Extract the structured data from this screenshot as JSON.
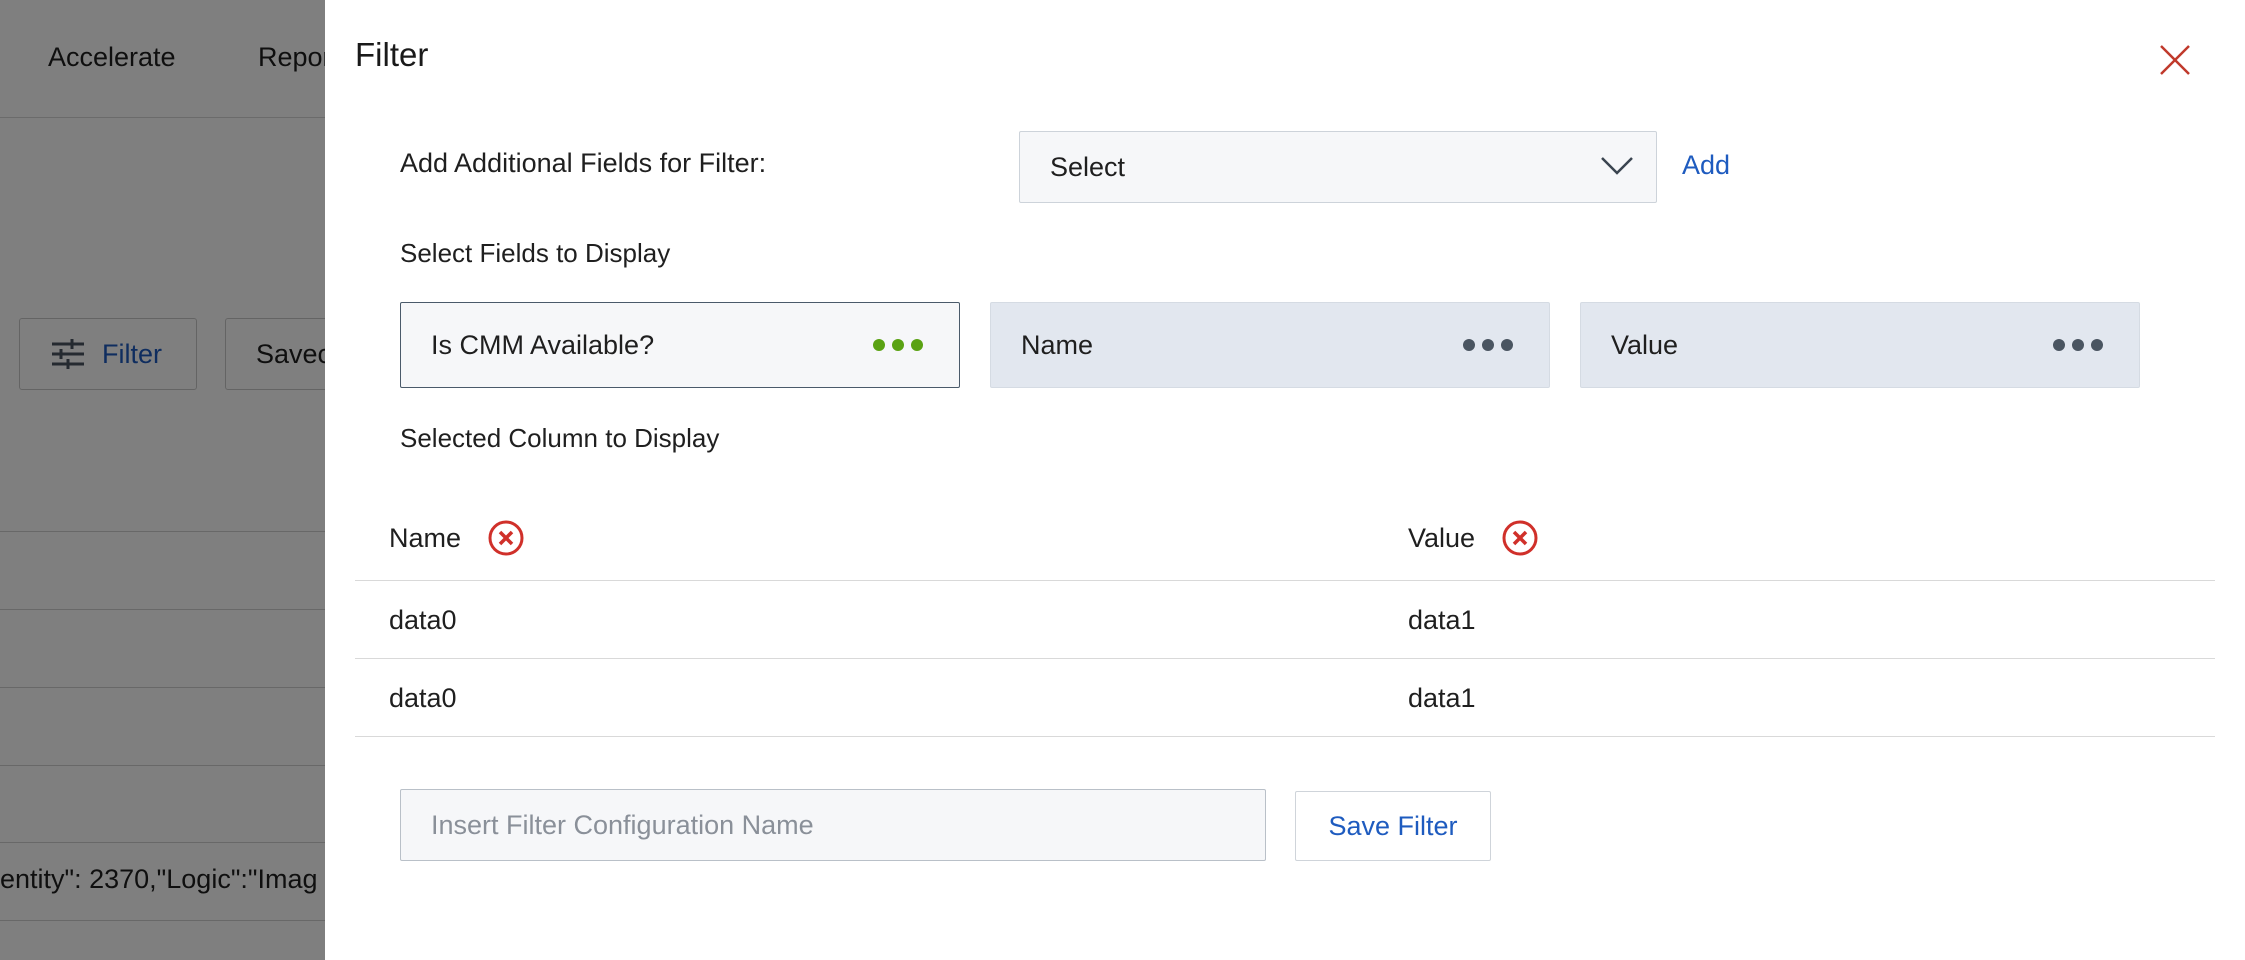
{
  "background": {
    "nav_items": [
      "Accelerate",
      "Repor"
    ],
    "filter_button": "Filter",
    "saved_button": "Savec",
    "code_text": "entity\": 2370,\"Logic\":\"Imag"
  },
  "drawer": {
    "title": "Filter",
    "add_fields_label": "Add Additional Fields for Filter:",
    "select": {
      "value": "Select"
    },
    "add_link": "Add",
    "select_fields_label": "Select Fields to Display",
    "field_cards": [
      {
        "label": "Is CMM Available?",
        "active": true
      },
      {
        "label": "Name",
        "active": false
      },
      {
        "label": "Value",
        "active": false
      }
    ],
    "selected_columns_label": "Selected Column to Display",
    "table": {
      "columns": [
        "Name",
        "Value"
      ],
      "rows": [
        [
          "data0",
          "data1"
        ],
        [
          "data0",
          "data1"
        ]
      ]
    },
    "config_name": {
      "value": "",
      "placeholder": "Insert Filter Configuration Name"
    },
    "save_button": "Save Filter"
  },
  "colors": {
    "accent_blue": "#1e5bbf",
    "close_red": "#c0392b",
    "remove_red": "#d0302a",
    "active_dots": "#5aa213",
    "inactive_dots": "#4a5561"
  }
}
